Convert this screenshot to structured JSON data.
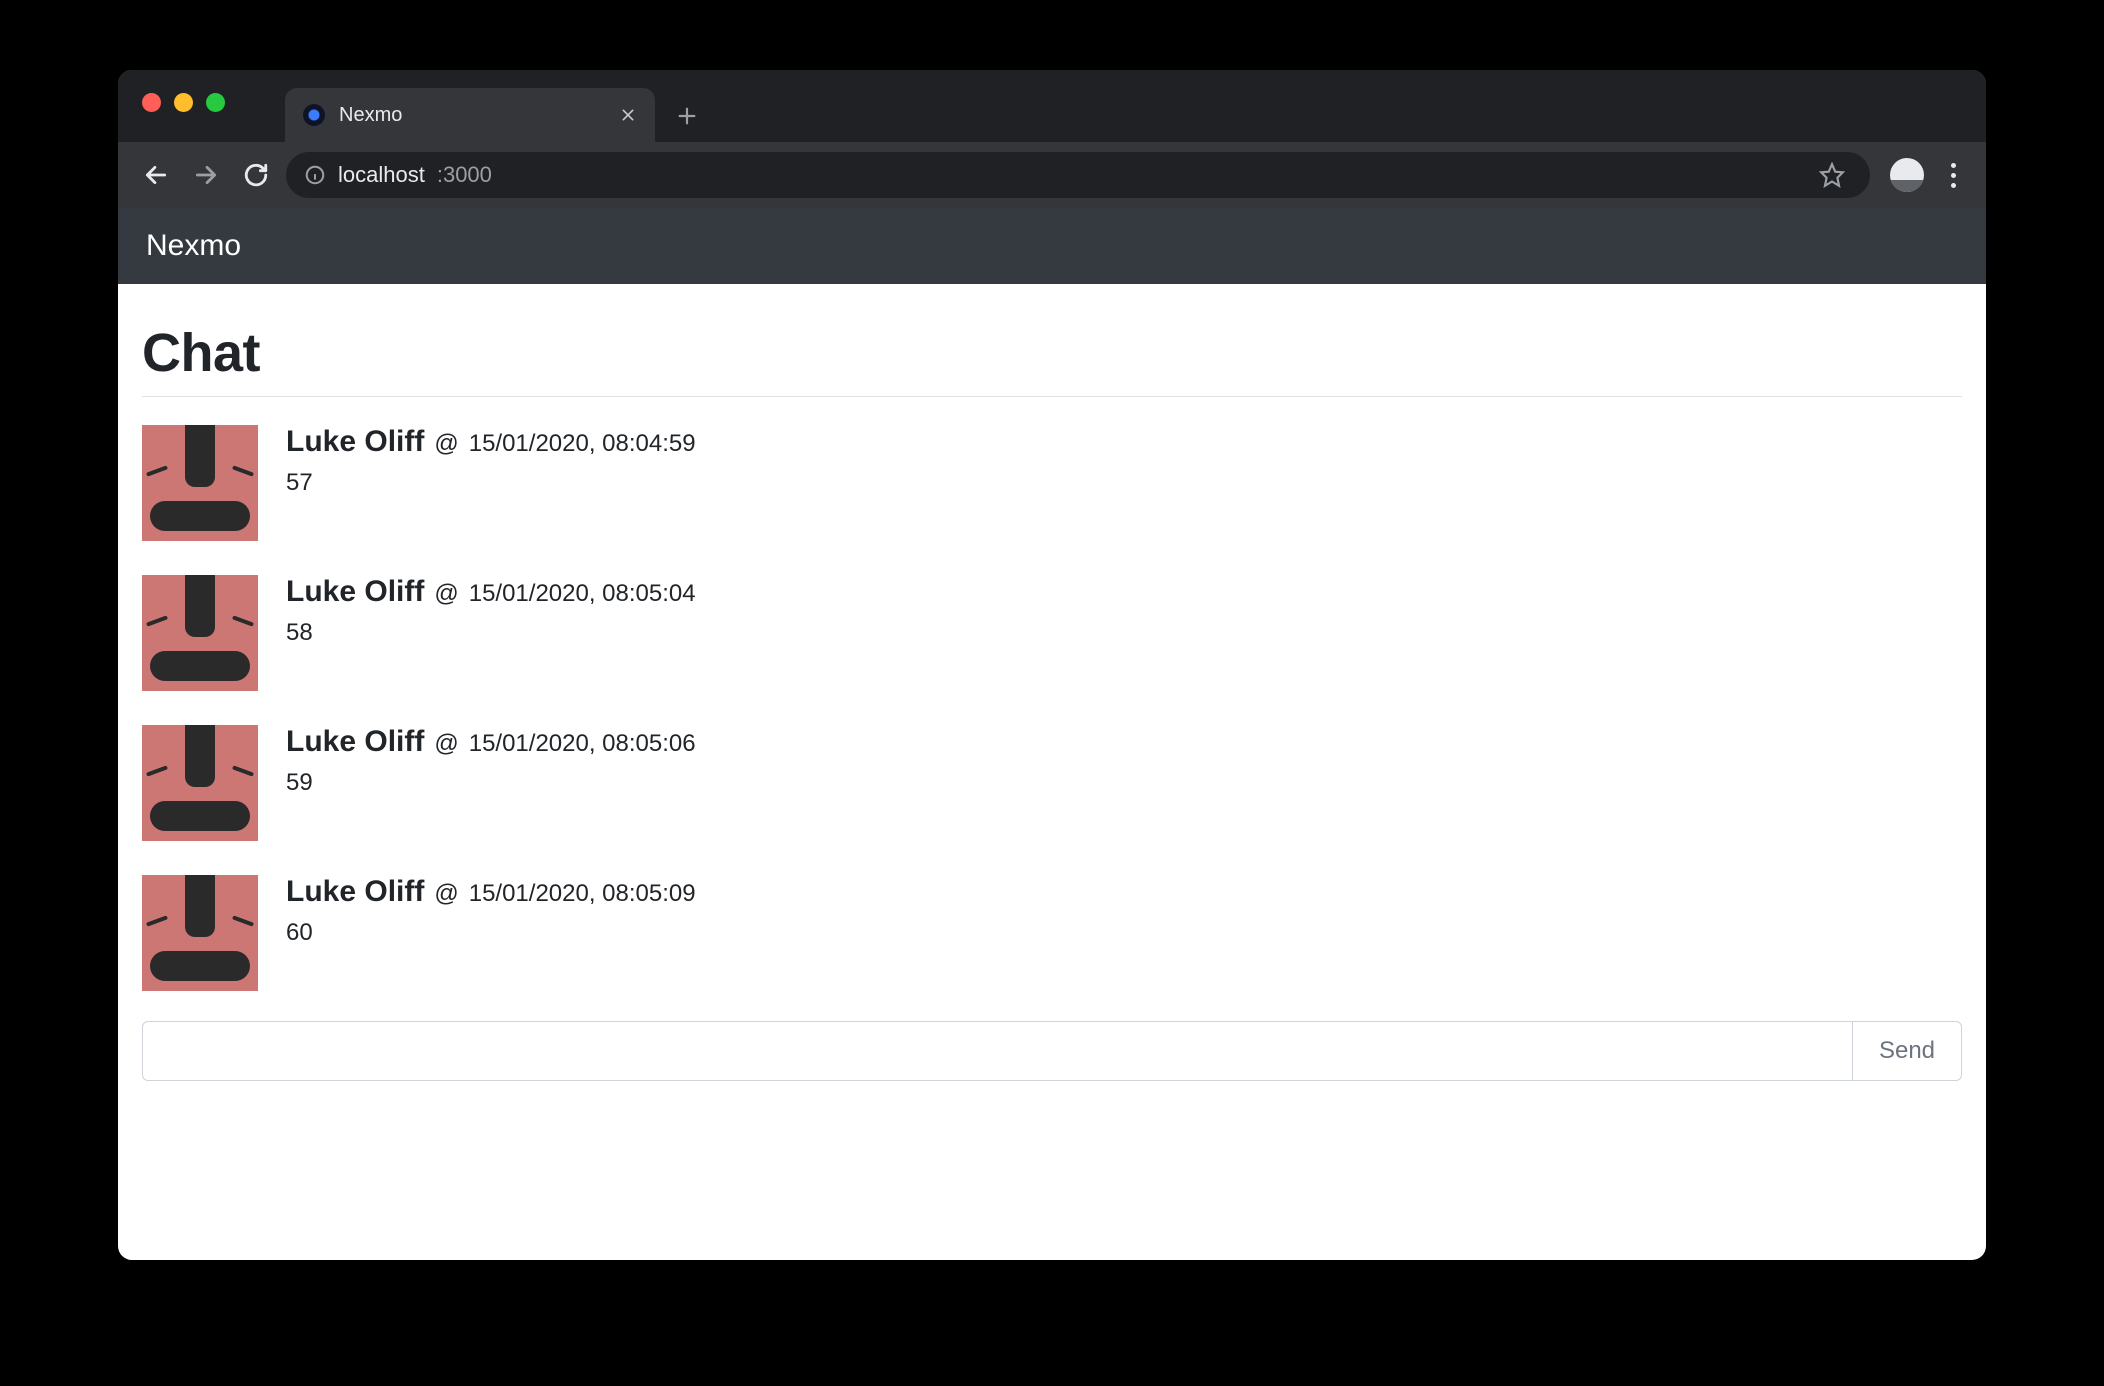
{
  "browser": {
    "tab_title": "Nexmo",
    "url_host": "localhost",
    "url_port": ":3000"
  },
  "app": {
    "brand": "Nexmo",
    "page_title": "Chat",
    "compose": {
      "placeholder": "",
      "value": "",
      "send_label": "Send"
    },
    "messages": [
      {
        "user": "Luke Oliff",
        "at": "@",
        "time": "15/01/2020, 08:04:59",
        "text": "57"
      },
      {
        "user": "Luke Oliff",
        "at": "@",
        "time": "15/01/2020, 08:05:04",
        "text": "58"
      },
      {
        "user": "Luke Oliff",
        "at": "@",
        "time": "15/01/2020, 08:05:06",
        "text": "59"
      },
      {
        "user": "Luke Oliff",
        "at": "@",
        "time": "15/01/2020, 08:05:09",
        "text": "60"
      }
    ]
  }
}
